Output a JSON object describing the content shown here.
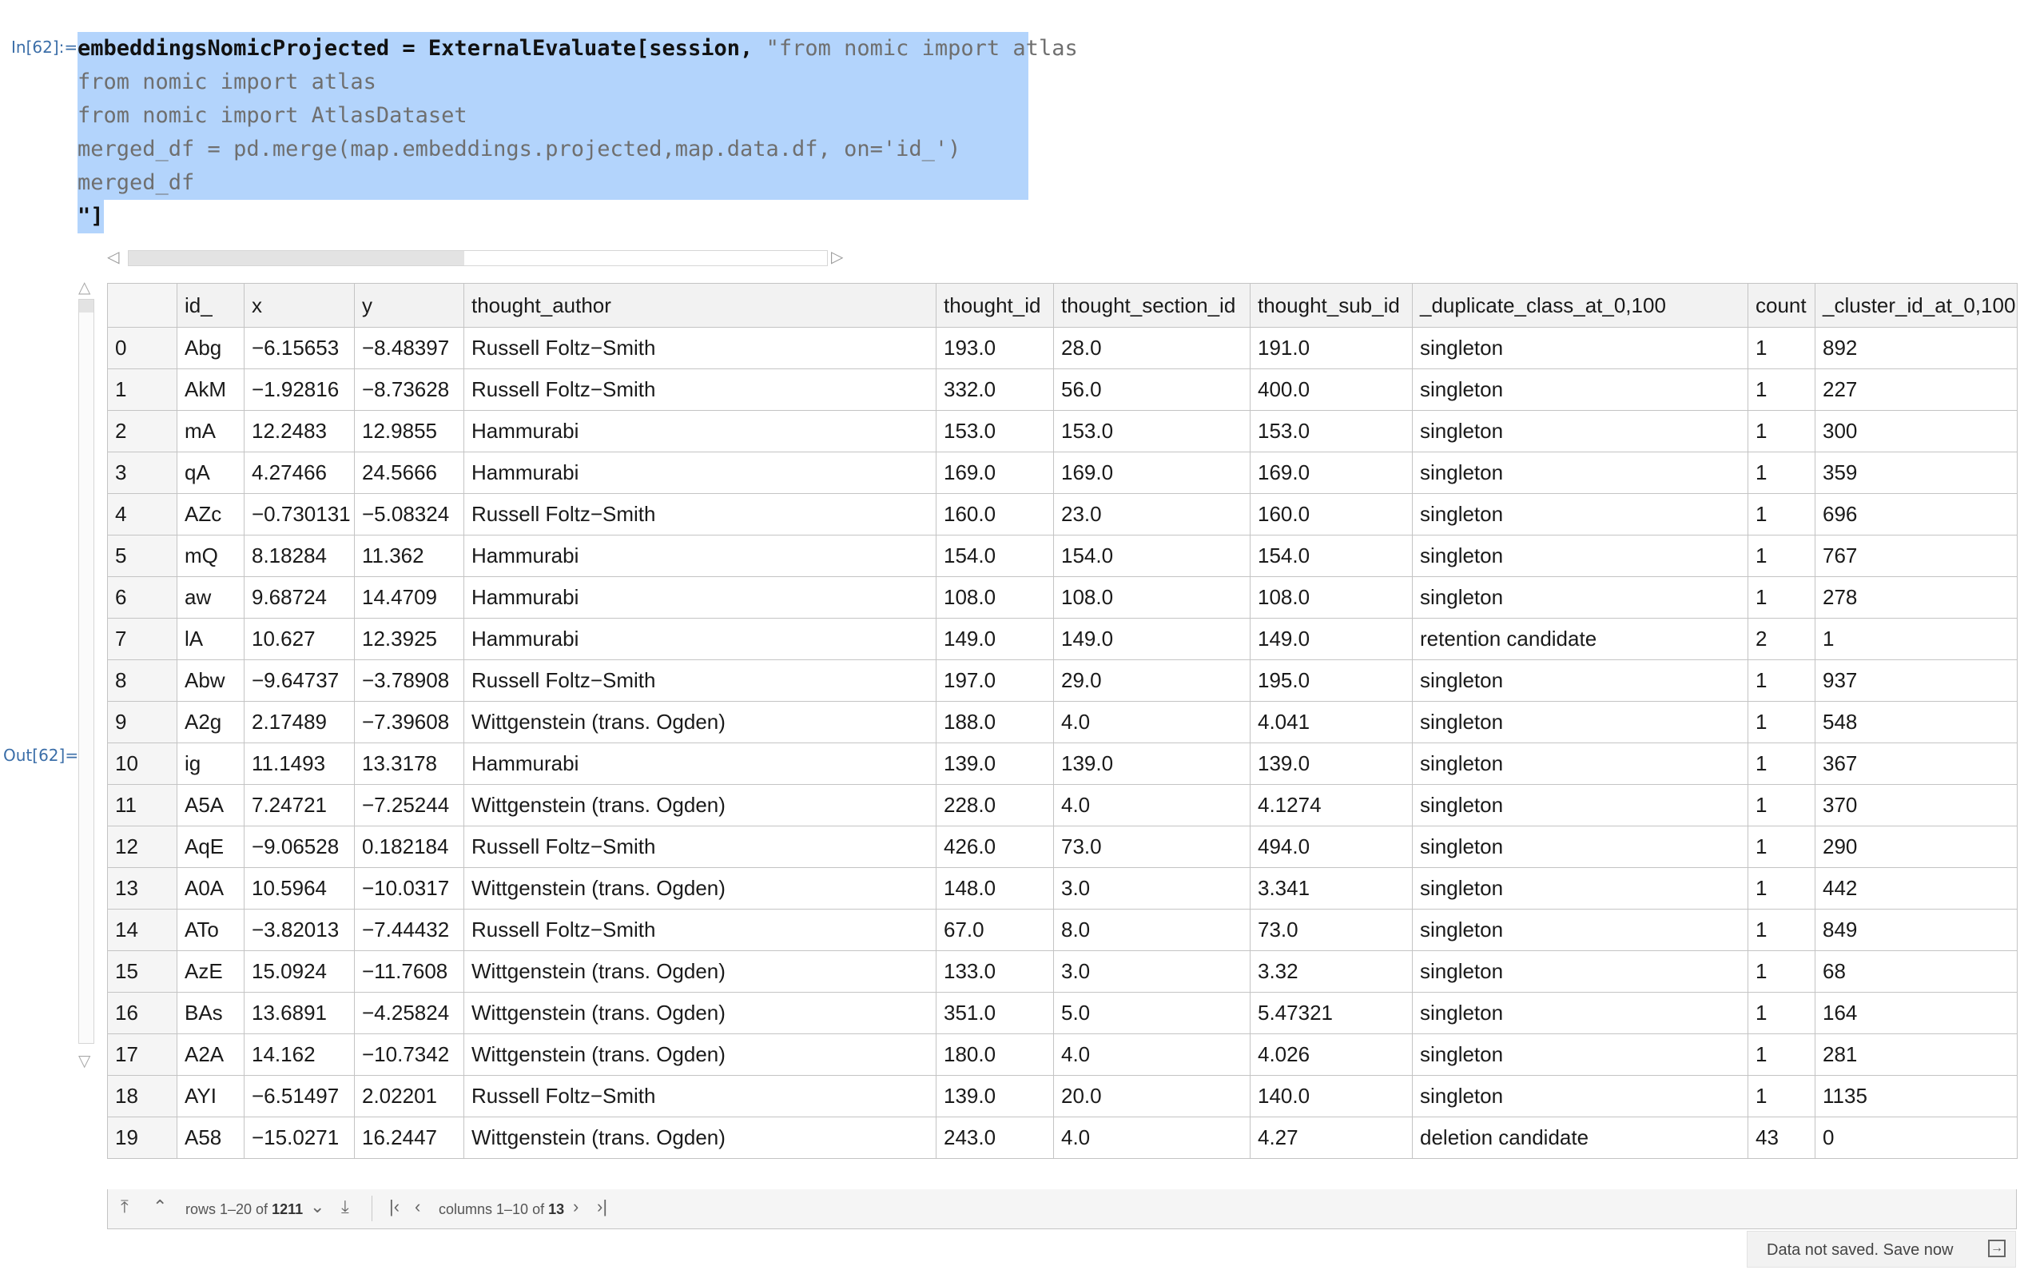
{
  "cell": {
    "in_label": "In[62]:=",
    "out_label": "Out[62]=",
    "code": {
      "line1_var": "embeddingsNomicProjected",
      "line1_eq": " = ",
      "line1_func": "ExternalEvaluate",
      "line1_args": "[session, ",
      "line1_str": "\"from nomic import atlas",
      "line2": "from nomic import atlas",
      "line3": "from nomic import AtlasDataset",
      "line4": "merged_df = pd.merge(map.embeddings.projected,map.data.df, on='id_')",
      "line5": "merged_df",
      "line6": "\"]"
    }
  },
  "scroll": {
    "horizontal_fraction": 0.48,
    "vertical_fraction": 0.017
  },
  "table": {
    "columns": [
      "",
      "id_",
      "x",
      "y",
      "thought_author",
      "thought_id",
      "thought_section_id",
      "thought_sub_id",
      "_duplicate_class_at_0,100",
      "count",
      "_cluster_id_at_0,100"
    ],
    "rows": [
      [
        "0",
        "Abg",
        "−6.15653",
        "−8.48397",
        "Russell Foltz−Smith",
        "193.0",
        "28.0",
        "191.0",
        "singleton",
        "1",
        "892"
      ],
      [
        "1",
        "AkM",
        "−1.92816",
        "−8.73628",
        "Russell Foltz−Smith",
        "332.0",
        "56.0",
        "400.0",
        "singleton",
        "1",
        "227"
      ],
      [
        "2",
        "mA",
        "12.2483",
        "12.9855",
        "Hammurabi",
        "153.0",
        "153.0",
        "153.0",
        "singleton",
        "1",
        "300"
      ],
      [
        "3",
        "qA",
        "4.27466",
        "24.5666",
        "Hammurabi",
        "169.0",
        "169.0",
        "169.0",
        "singleton",
        "1",
        "359"
      ],
      [
        "4",
        "AZc",
        "−0.730131",
        "−5.08324",
        "Russell Foltz−Smith",
        "160.0",
        "23.0",
        "160.0",
        "singleton",
        "1",
        "696"
      ],
      [
        "5",
        "mQ",
        "8.18284",
        "11.362",
        "Hammurabi",
        "154.0",
        "154.0",
        "154.0",
        "singleton",
        "1",
        "767"
      ],
      [
        "6",
        "aw",
        "9.68724",
        "14.4709",
        "Hammurabi",
        "108.0",
        "108.0",
        "108.0",
        "singleton",
        "1",
        "278"
      ],
      [
        "7",
        "lA",
        "10.627",
        "12.3925",
        "Hammurabi",
        "149.0",
        "149.0",
        "149.0",
        "retention candidate",
        "2",
        "1"
      ],
      [
        "8",
        "Abw",
        "−9.64737",
        "−3.78908",
        "Russell Foltz−Smith",
        "197.0",
        "29.0",
        "195.0",
        "singleton",
        "1",
        "937"
      ],
      [
        "9",
        "A2g",
        "2.17489",
        "−7.39608",
        "Wittgenstein (trans. Ogden)",
        "188.0",
        "4.0",
        "4.041",
        "singleton",
        "1",
        "548"
      ],
      [
        "10",
        "ig",
        "11.1493",
        "13.3178",
        "Hammurabi",
        "139.0",
        "139.0",
        "139.0",
        "singleton",
        "1",
        "367"
      ],
      [
        "11",
        "A5A",
        "7.24721",
        "−7.25244",
        "Wittgenstein (trans. Ogden)",
        "228.0",
        "4.0",
        "4.1274",
        "singleton",
        "1",
        "370"
      ],
      [
        "12",
        "AqE",
        "−9.06528",
        "0.182184",
        "Russell Foltz−Smith",
        "426.0",
        "73.0",
        "494.0",
        "singleton",
        "1",
        "290"
      ],
      [
        "13",
        "A0A",
        "10.5964",
        "−10.0317",
        "Wittgenstein (trans. Ogden)",
        "148.0",
        "3.0",
        "3.341",
        "singleton",
        "1",
        "442"
      ],
      [
        "14",
        "ATo",
        "−3.82013",
        "−7.44432",
        "Russell Foltz−Smith",
        "67.0",
        "8.0",
        "73.0",
        "singleton",
        "1",
        "849"
      ],
      [
        "15",
        "AzE",
        "15.0924",
        "−11.7608",
        "Wittgenstein (trans. Ogden)",
        "133.0",
        "3.0",
        "3.32",
        "singleton",
        "1",
        "68"
      ],
      [
        "16",
        "BAs",
        "13.6891",
        "−4.25824",
        "Wittgenstein (trans. Ogden)",
        "351.0",
        "5.0",
        "5.47321",
        "singleton",
        "1",
        "164"
      ],
      [
        "17",
        "A2A",
        "14.162",
        "−10.7342",
        "Wittgenstein (trans. Ogden)",
        "180.0",
        "4.0",
        "4.026",
        "singleton",
        "1",
        "281"
      ],
      [
        "18",
        "AYI",
        "−6.51497",
        "2.02201",
        "Russell Foltz−Smith",
        "139.0",
        "20.0",
        "140.0",
        "singleton",
        "1",
        "1135"
      ],
      [
        "19",
        "A58",
        "−15.0271",
        "16.2447",
        "Wittgenstein (trans. Ogden)",
        "243.0",
        "4.0",
        "4.27",
        "deletion candidate",
        "43",
        "0"
      ]
    ]
  },
  "footer": {
    "rows_prefix": "rows 1–20 of ",
    "rows_total": "1211",
    "cols_prefix": "columns 1–10 of ",
    "cols_total": "13"
  },
  "savebar": {
    "text": "Data not saved. Save now"
  }
}
